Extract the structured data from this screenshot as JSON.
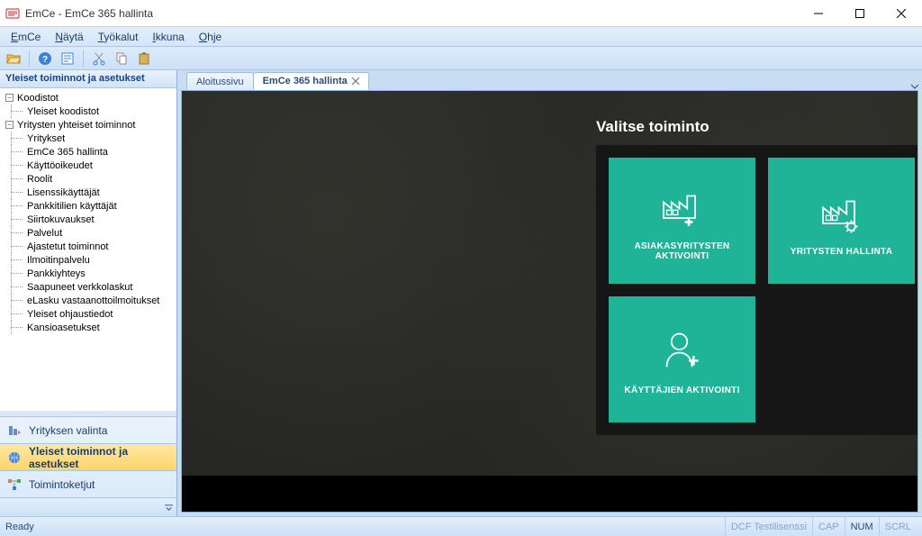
{
  "window": {
    "title": "EmCe - EmCe 365 hallinta"
  },
  "menu": {
    "emce": "EmCe",
    "nayta": "Näytä",
    "tyokalut": "Työkalut",
    "ikkuna": "Ikkuna",
    "ohje": "Ohje"
  },
  "sidebar": {
    "header": "Yleiset toiminnot ja asetukset",
    "nodes": {
      "koodistot": "Koodistot",
      "yleiset_koodistot": "Yleiset koodistot",
      "yritysten_yhteiset": "Yritysten yhteiset toiminnot",
      "yritykset": "Yritykset",
      "emce365": "EmCe 365 hallinta",
      "kayttooikeudet": "Käyttöoikeudet",
      "roolit": "Roolit",
      "lisenssikayttajat": "Lisenssikäyttäjät",
      "pankkitilien": "Pankkitilien käyttäjät",
      "siirtokuvaukset": "Siirtokuvaukset",
      "palvelut": "Palvelut",
      "ajastetut": "Ajastetut toiminnot",
      "ilmoitinpalvelu": "Ilmoitinpalvelu",
      "pankkiyhteys": "Pankkiyhteys",
      "saapuneet": "Saapuneet verkkolaskut",
      "elasku": "eLasku vastaanottoilmoitukset",
      "yleiset_ohjaus": "Yleiset ohjaustiedot",
      "kansioasetukset": "Kansioasetukset"
    },
    "nav": {
      "yrityksen_valinta": "Yrityksen valinta",
      "yleiset_toiminnot": "Yleiset toiminnot ja asetukset",
      "toimintoketjut": "Toimintoketjut"
    }
  },
  "tabs": {
    "aloitussivu": "Aloitussivu",
    "emce365": "EmCe 365 hallinta"
  },
  "panel": {
    "title": "Valitse toiminto",
    "tiles": {
      "asiakas": "ASIAKASYRITYSTEN AKTIVOINTI",
      "yritysten": "YRITYSTEN HALLINTA",
      "kayttajien": "KÄYTTÄJIEN AKTIVOINTI"
    }
  },
  "status": {
    "ready": "Ready",
    "license": "DCF Testilisenssi",
    "cap": "CAP",
    "num": "NUM",
    "scrl": "SCRL"
  }
}
